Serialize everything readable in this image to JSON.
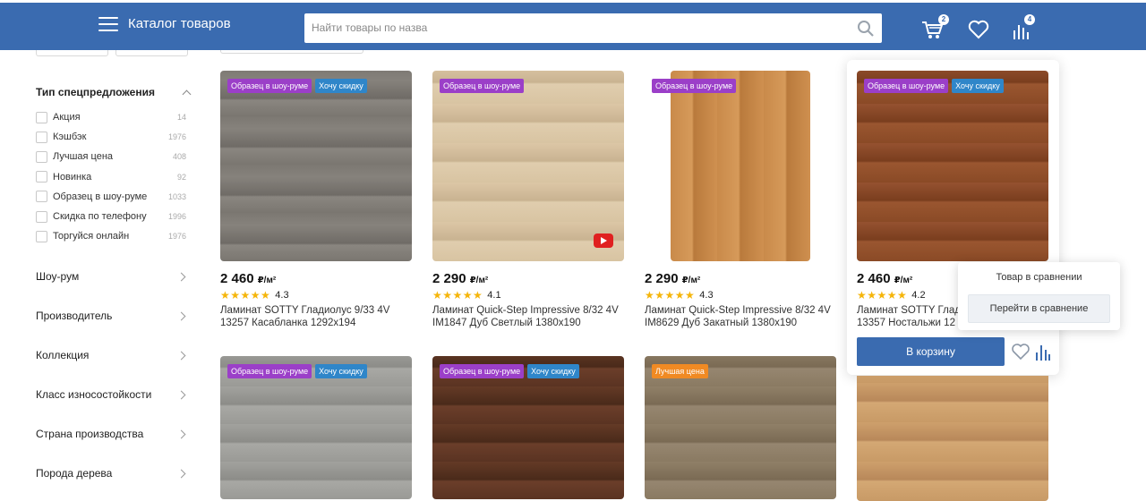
{
  "header": {
    "catalog_title": "Каталог товаров",
    "search_value": "Найти товары по назва",
    "cart_count": "2",
    "compare_count": "4"
  },
  "filters": {
    "special_offer": {
      "title": "Тип спецпредложения",
      "options": [
        {
          "label": "Акция",
          "count": "14"
        },
        {
          "label": "Кэшбэк",
          "count": "1976"
        },
        {
          "label": "Лучшая цена",
          "count": "408"
        },
        {
          "label": "Новинка",
          "count": "92"
        },
        {
          "label": "Образец в шоу-руме",
          "count": "1033"
        },
        {
          "label": "Скидка по телефону",
          "count": "1996"
        },
        {
          "label": "Торгуйся онлайн",
          "count": "1976"
        }
      ]
    },
    "sections": [
      "Шоу-рум",
      "Производитель",
      "Коллекция",
      "Класс износостойкости",
      "Страна производства",
      "Порода дерева"
    ]
  },
  "products": [
    {
      "tags": [
        "Образец в шоу-руме",
        "Хочу скидку"
      ],
      "price": "2 460",
      "unit": "₽/м²",
      "rating": "4.3",
      "stars": "★★★★★",
      "title": "Ламинат SOTTY Гладиолус 9/33 4V 13257 Касабланка 1292х194"
    },
    {
      "tags": [
        "Образец в шоу-руме"
      ],
      "price": "2 290",
      "unit": "₽/м²",
      "rating": "4.1",
      "stars": "★★★★★",
      "title": "Ламинат Quick-Step Impressive 8/32 4V IM1847 Дуб Светлый 1380х190"
    },
    {
      "tags": [
        "Образец в шоу-руме"
      ],
      "price": "2 290",
      "unit": "₽/м²",
      "rating": "4.3",
      "stars": "★★★★★",
      "title": "Ламинат Quick-Step Impressive 8/32 4V IM8629 Дуб Закатный 1380х190"
    },
    {
      "tags": [
        "Образец в шоу-руме",
        "Хочу скидку"
      ],
      "price": "2 460",
      "unit": "₽/м²",
      "rating": "4.2",
      "stars": "★★★★★",
      "title": "Ламинат SOTTY Глад 13357 Ностальжи 12"
    },
    {
      "tags": [
        "Образец в шоу-руме",
        "Хочу скидку"
      ]
    },
    {
      "tags": [
        "Образец в шоу-руме",
        "Хочу скидку"
      ]
    },
    {
      "tags": [
        "Лучшая цена"
      ]
    },
    {
      "tags": []
    }
  ],
  "hover_card": {
    "cart_button": "В корзину"
  },
  "compare_popup": {
    "title": "Товар в сравнении",
    "button": "Перейти в сравнение"
  },
  "colors": {
    "brand": "#3a6bb0",
    "tag_purple": "#9b3fc8",
    "tag_blue": "#2f86c9",
    "tag_orange": "#f08a23",
    "star": "#f5b50a"
  }
}
